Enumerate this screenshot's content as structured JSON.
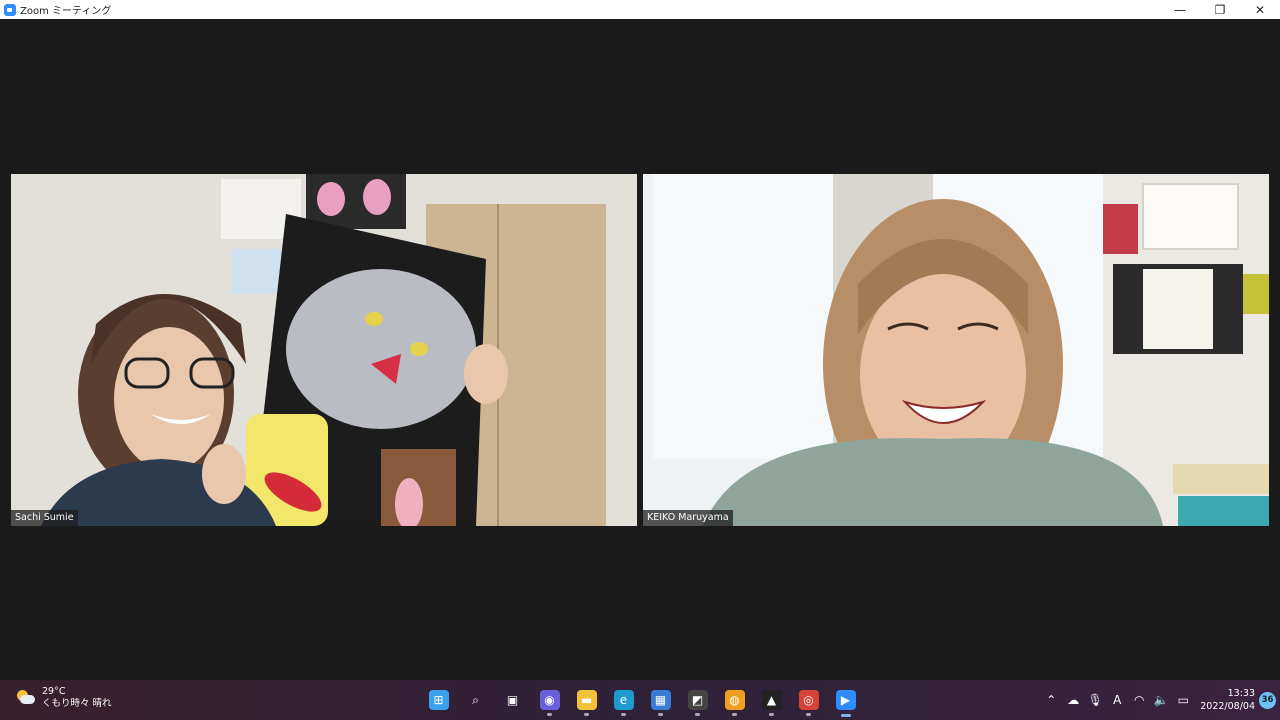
{
  "window": {
    "title": "Zoom ミーティング",
    "controls": {
      "minimize": "—",
      "maximize": "❐",
      "close": "✕"
    }
  },
  "participants": [
    {
      "name": "Sachi Sumie"
    },
    {
      "name": "KEIKO Maruyama"
    }
  ],
  "taskbar": {
    "weather": {
      "temperature": "29°C",
      "condition": "くもり時々 晴れ"
    },
    "apps": [
      {
        "name": "start-icon",
        "glyph": "⊞",
        "color": "#3aa0f0"
      },
      {
        "name": "search-icon",
        "glyph": "⌕",
        "color": "transparent"
      },
      {
        "name": "task-view-icon",
        "glyph": "▣",
        "color": "transparent"
      },
      {
        "name": "teams-chat-icon",
        "glyph": "◉",
        "color": "#6a5fd8"
      },
      {
        "name": "file-explorer-icon",
        "glyph": "▬",
        "color": "#f2c23a"
      },
      {
        "name": "edge-icon",
        "glyph": "e",
        "color": "#1f9bd0"
      },
      {
        "name": "microsoft-store-icon",
        "glyph": "▦",
        "color": "#3a7bd5"
      },
      {
        "name": "snipping-tool-icon",
        "glyph": "◩",
        "color": "#444"
      },
      {
        "name": "app-orange-icon",
        "glyph": "◍",
        "color": "#f0a020"
      },
      {
        "name": "app-triangle-icon",
        "glyph": "▲",
        "color": "#222"
      },
      {
        "name": "chrome-icon",
        "glyph": "◎",
        "color": "#d64235"
      },
      {
        "name": "zoom-icon",
        "glyph": "▶",
        "color": "#2D8CFF"
      }
    ],
    "tray": {
      "icons": [
        "chevron-up-icon",
        "onedrive-icon",
        "microphone-icon",
        "ime-icon",
        "wifi-icon",
        "volume-icon",
        "battery-icon"
      ],
      "ime_label": "A",
      "time": "13:33",
      "date": "2022/08/04",
      "notification_count": "36"
    }
  }
}
